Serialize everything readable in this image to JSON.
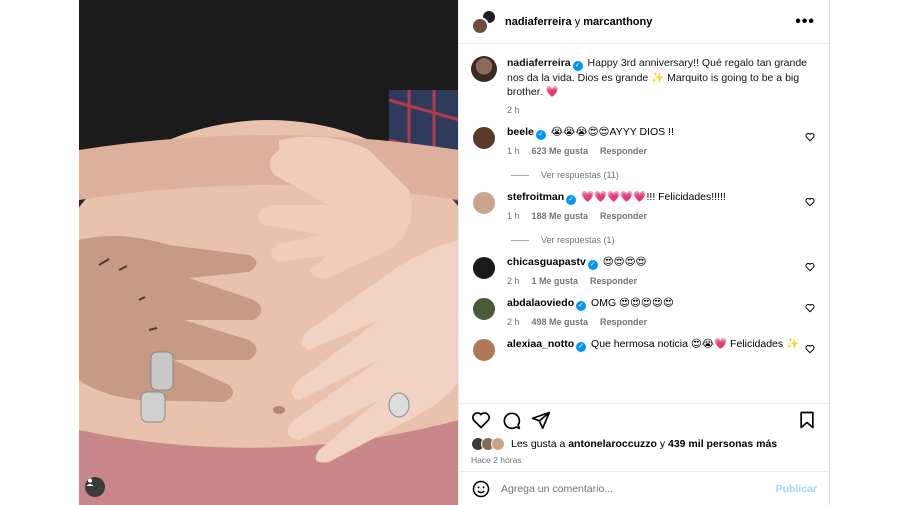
{
  "header": {
    "user1": "nadiaferreira",
    "joiner": "y",
    "user2": "marcanthony"
  },
  "caption": {
    "username": "nadiaferreira",
    "text": "Happy 3rd anniversary!! Qué regalo tan grande nos da la vida. Dios es grande ✨ Marquito is going to be a big brother. 💗",
    "time": "2 h"
  },
  "comments": [
    {
      "username": "beele",
      "text": "😭😭😭😍😍AYYY DIOS !!",
      "time": "1 h",
      "likes": "623 Me gusta",
      "reply": "Responder",
      "replies": "Ver respuestas (11)",
      "avatar_color": "#5a3a2a"
    },
    {
      "username": "stefroitman",
      "text": "💗💗💗💗💗!!! Felicidades!!!!!",
      "time": "1 h",
      "likes": "188 Me gusta",
      "reply": "Responder",
      "replies": "Ver respuestas (1)",
      "avatar_color": "#c9a48a"
    },
    {
      "username": "chicasguapastv",
      "text": "😍😍😍😍",
      "time": "2 h",
      "likes": "1 Me gusta",
      "reply": "Responder",
      "replies": "",
      "avatar_color": "#1a1a1a"
    },
    {
      "username": "abdalaoviedo",
      "text": "OMG 😍😍😍😍😍",
      "time": "2 h",
      "likes": "498 Me gusta",
      "reply": "Responder",
      "replies": "",
      "avatar_color": "#4a5a3a"
    },
    {
      "username": "alexiaa_notto",
      "text": "Que hermosa noticia 😍😭💗 Felicidades ✨",
      "time": "",
      "likes": "",
      "reply": "",
      "replies": "",
      "avatar_color": "#b07a5a"
    }
  ],
  "likes": {
    "prefix": "Les gusta a",
    "user": "antonelaroccuzzo",
    "mid": "y",
    "count": "439 mil personas más"
  },
  "time_ago": "Hace 2 horas",
  "composer": {
    "placeholder": "Agrega un comentario...",
    "publish": "Publicar"
  },
  "colors": {
    "accent": "#0095f6",
    "publish_disabled": "#a3d4fb",
    "muted": "#737373"
  }
}
